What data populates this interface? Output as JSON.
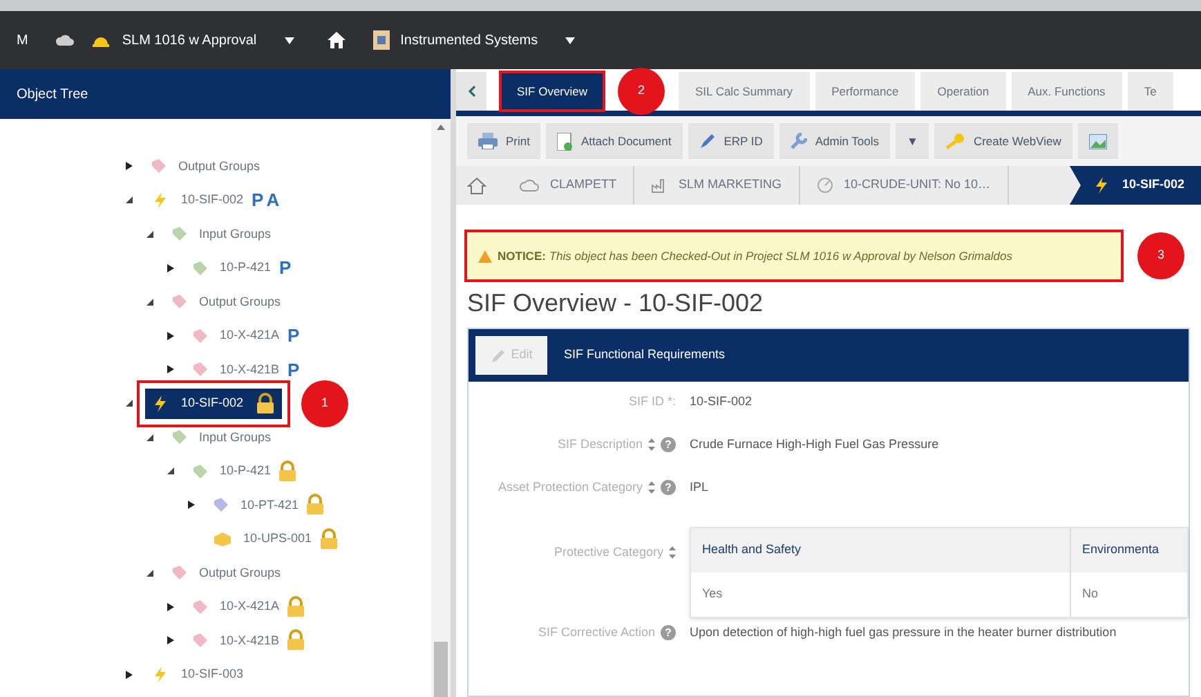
{
  "top_bar": {
    "app_name": "M",
    "project": "SLM 1016 w Approval",
    "module": "Instrumented Systems"
  },
  "object_tree": {
    "title": "Object Tree",
    "items": [
      {
        "label": "Output Groups",
        "kind": "output",
        "expanded": false,
        "selected": false
      },
      {
        "label": "10-SIF-002",
        "kind": "sif",
        "expanded": true,
        "selected": false,
        "badges": [
          "P",
          "A"
        ],
        "children": [
          {
            "label": "Input Groups",
            "kind": "input",
            "expanded": true,
            "selected": false,
            "children": [
              {
                "label": "10-P-421",
                "kind": "input",
                "expanded": false,
                "selected": false,
                "badges": [
                  "P"
                ]
              }
            ]
          },
          {
            "label": "Output Groups",
            "kind": "output",
            "expanded": true,
            "selected": false,
            "children": [
              {
                "label": "10-X-421A",
                "kind": "output",
                "expanded": false,
                "selected": false,
                "badges": [
                  "P"
                ]
              },
              {
                "label": "10-X-421B",
                "kind": "output",
                "expanded": false,
                "selected": false,
                "badges": [
                  "P"
                ]
              }
            ]
          }
        ]
      },
      {
        "label": "10-SIF-002",
        "kind": "sif",
        "expanded": true,
        "selected": true,
        "locked": true,
        "callout": "1",
        "children": [
          {
            "label": "Input Groups",
            "kind": "input",
            "expanded": true,
            "selected": false,
            "children": [
              {
                "label": "10-P-421",
                "kind": "input",
                "expanded": true,
                "selected": false,
                "locked": true,
                "children": [
                  {
                    "label": "10-PT-421",
                    "kind": "device",
                    "expanded": false,
                    "selected": false,
                    "locked": true
                  },
                  {
                    "label": "10-UPS-001",
                    "kind": "ups",
                    "selected": false,
                    "locked": true
                  }
                ]
              }
            ]
          },
          {
            "label": "Output Groups",
            "kind": "output",
            "expanded": true,
            "selected": false,
            "children": [
              {
                "label": "10-X-421A",
                "kind": "output",
                "expanded": false,
                "selected": false,
                "locked": true
              },
              {
                "label": "10-X-421B",
                "kind": "output",
                "expanded": false,
                "selected": false,
                "locked": true
              }
            ]
          }
        ]
      },
      {
        "label": "10-SIF-003",
        "kind": "sif",
        "expanded": false,
        "selected": false
      }
    ]
  },
  "tabs": [
    {
      "label": "SIF Overview",
      "selected": true,
      "callout": "2"
    },
    {
      "label": "SIL Calc Summary",
      "selected": false
    },
    {
      "label": "Performance",
      "selected": false
    },
    {
      "label": "Operation",
      "selected": false
    },
    {
      "label": "Aux. Functions",
      "selected": false
    },
    {
      "label": "Te",
      "selected": false
    }
  ],
  "toolbar": [
    {
      "label": "Print",
      "kind": "printer"
    },
    {
      "label": "Attach Document",
      "kind": "document"
    },
    {
      "label": "ERP ID",
      "kind": "pen"
    },
    {
      "label": "Admin Tools",
      "kind": "wrench"
    },
    {
      "label": "▼",
      "kind": "menu"
    },
    {
      "label": "Create WebView",
      "kind": "key"
    },
    {
      "kind": "image"
    }
  ],
  "breadcrumb": [
    {
      "label": "CLAMPETT",
      "kind": "cloud",
      "selected": false
    },
    {
      "label": "SLM MARKETING",
      "kind": "plant",
      "selected": false
    },
    {
      "label": "10-CRUDE-UNIT: No 10…",
      "kind": "unit",
      "selected": false
    },
    {
      "label": "10-SIF-002",
      "kind": "sif",
      "selected": true
    }
  ],
  "notice": {
    "text": "**NOTICE:** *This object has been Checked-Out in Project SLM 1016 w Approval by Nelson Grimaldos*",
    "callout": "3"
  },
  "page_title": "SIF Overview - 10-SIF-002",
  "card": {
    "edit_button": "Edit",
    "title": "SIF Functional Requirements",
    "fields": [
      {
        "label": "SIF ID *:",
        "kind": "text",
        "sortable": false,
        "value": "10-SIF-002"
      },
      {
        "label": "SIF Description",
        "kind": "text",
        "sortable": true,
        "help": "?",
        "value": "Crude Furnace High-High Fuel Gas Pressure"
      },
      {
        "label": "Asset Protection Category",
        "kind": "text",
        "sortable": true,
        "help": "?",
        "value": "IPL"
      },
      {
        "label": "Protective Category",
        "kind": "table",
        "sortable": true,
        "columns": [
          "Health and Safety",
          "Environmenta"
        ],
        "rows": [
          [
            "Yes",
            "No"
          ]
        ]
      },
      {
        "label": "SIF Corrective Action",
        "kind": "text",
        "sortable": false,
        "help": "?",
        "value": "Upon detection of high-high fuel gas pressure in the heater burner distribution"
      }
    ]
  }
}
